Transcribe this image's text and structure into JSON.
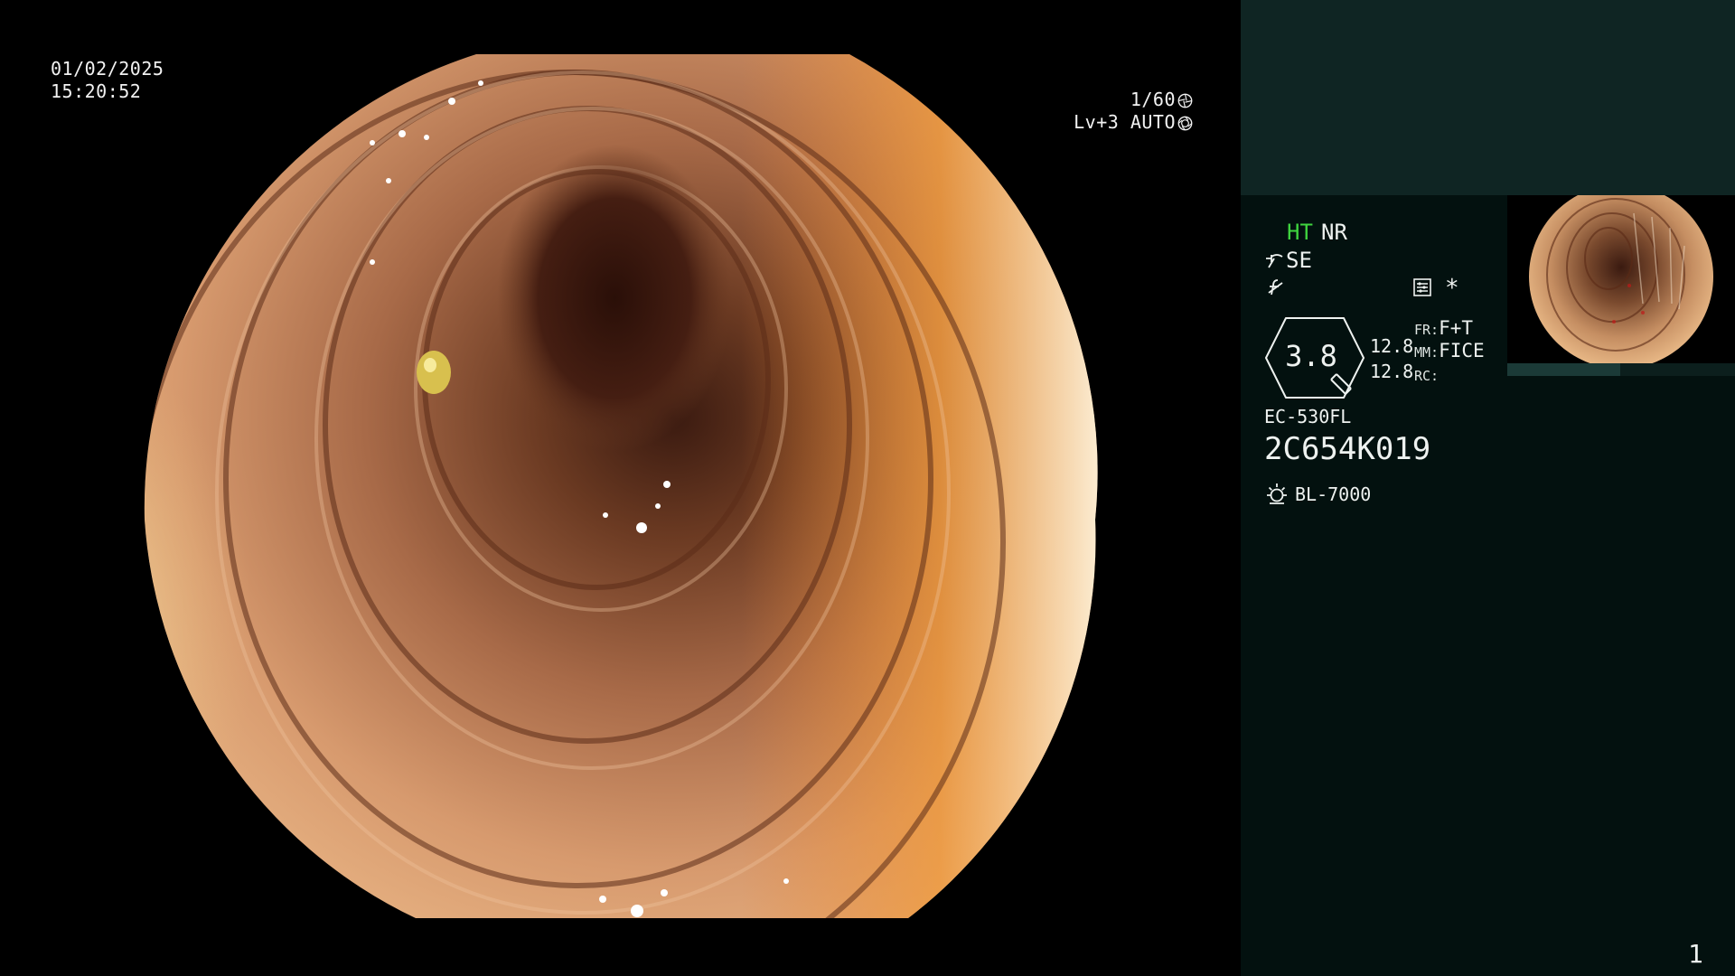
{
  "overlay": {
    "date": "01/02/2025",
    "time": "15:20:52",
    "shutter": "1/60",
    "shutter_icon": "aperture-icon",
    "iris_level": "Lv+3",
    "iris_mode": "AUTO",
    "iris_icon": "iris-icon"
  },
  "panel": {
    "mode_ht": "HT",
    "mode_nr": "NR",
    "structure_enhancement": "SE",
    "structure_icon": "structure-enhance-icon",
    "f_icon": "filter-off-icon",
    "menu_icon": "menu-list-icon",
    "asterisk": "*",
    "zoom": "3.8",
    "value_1": "12.8",
    "value_2": "12.8",
    "fr_label": "FR:",
    "fr_value": "F+T",
    "mm_label": "MM:",
    "mm_value": "FICE",
    "rc_label": "RC:",
    "rc_value": "",
    "scope_model": "EC-530FL",
    "scope_serial": "2C654K019",
    "light_source": "BL-7000",
    "light_icon": "light-source-icon",
    "page_number": "1"
  },
  "colors": {
    "panel_background": "#03110f",
    "panel_header": "#0f2523",
    "ht_highlight": "#3fd43f",
    "text": "#eef2f0"
  }
}
